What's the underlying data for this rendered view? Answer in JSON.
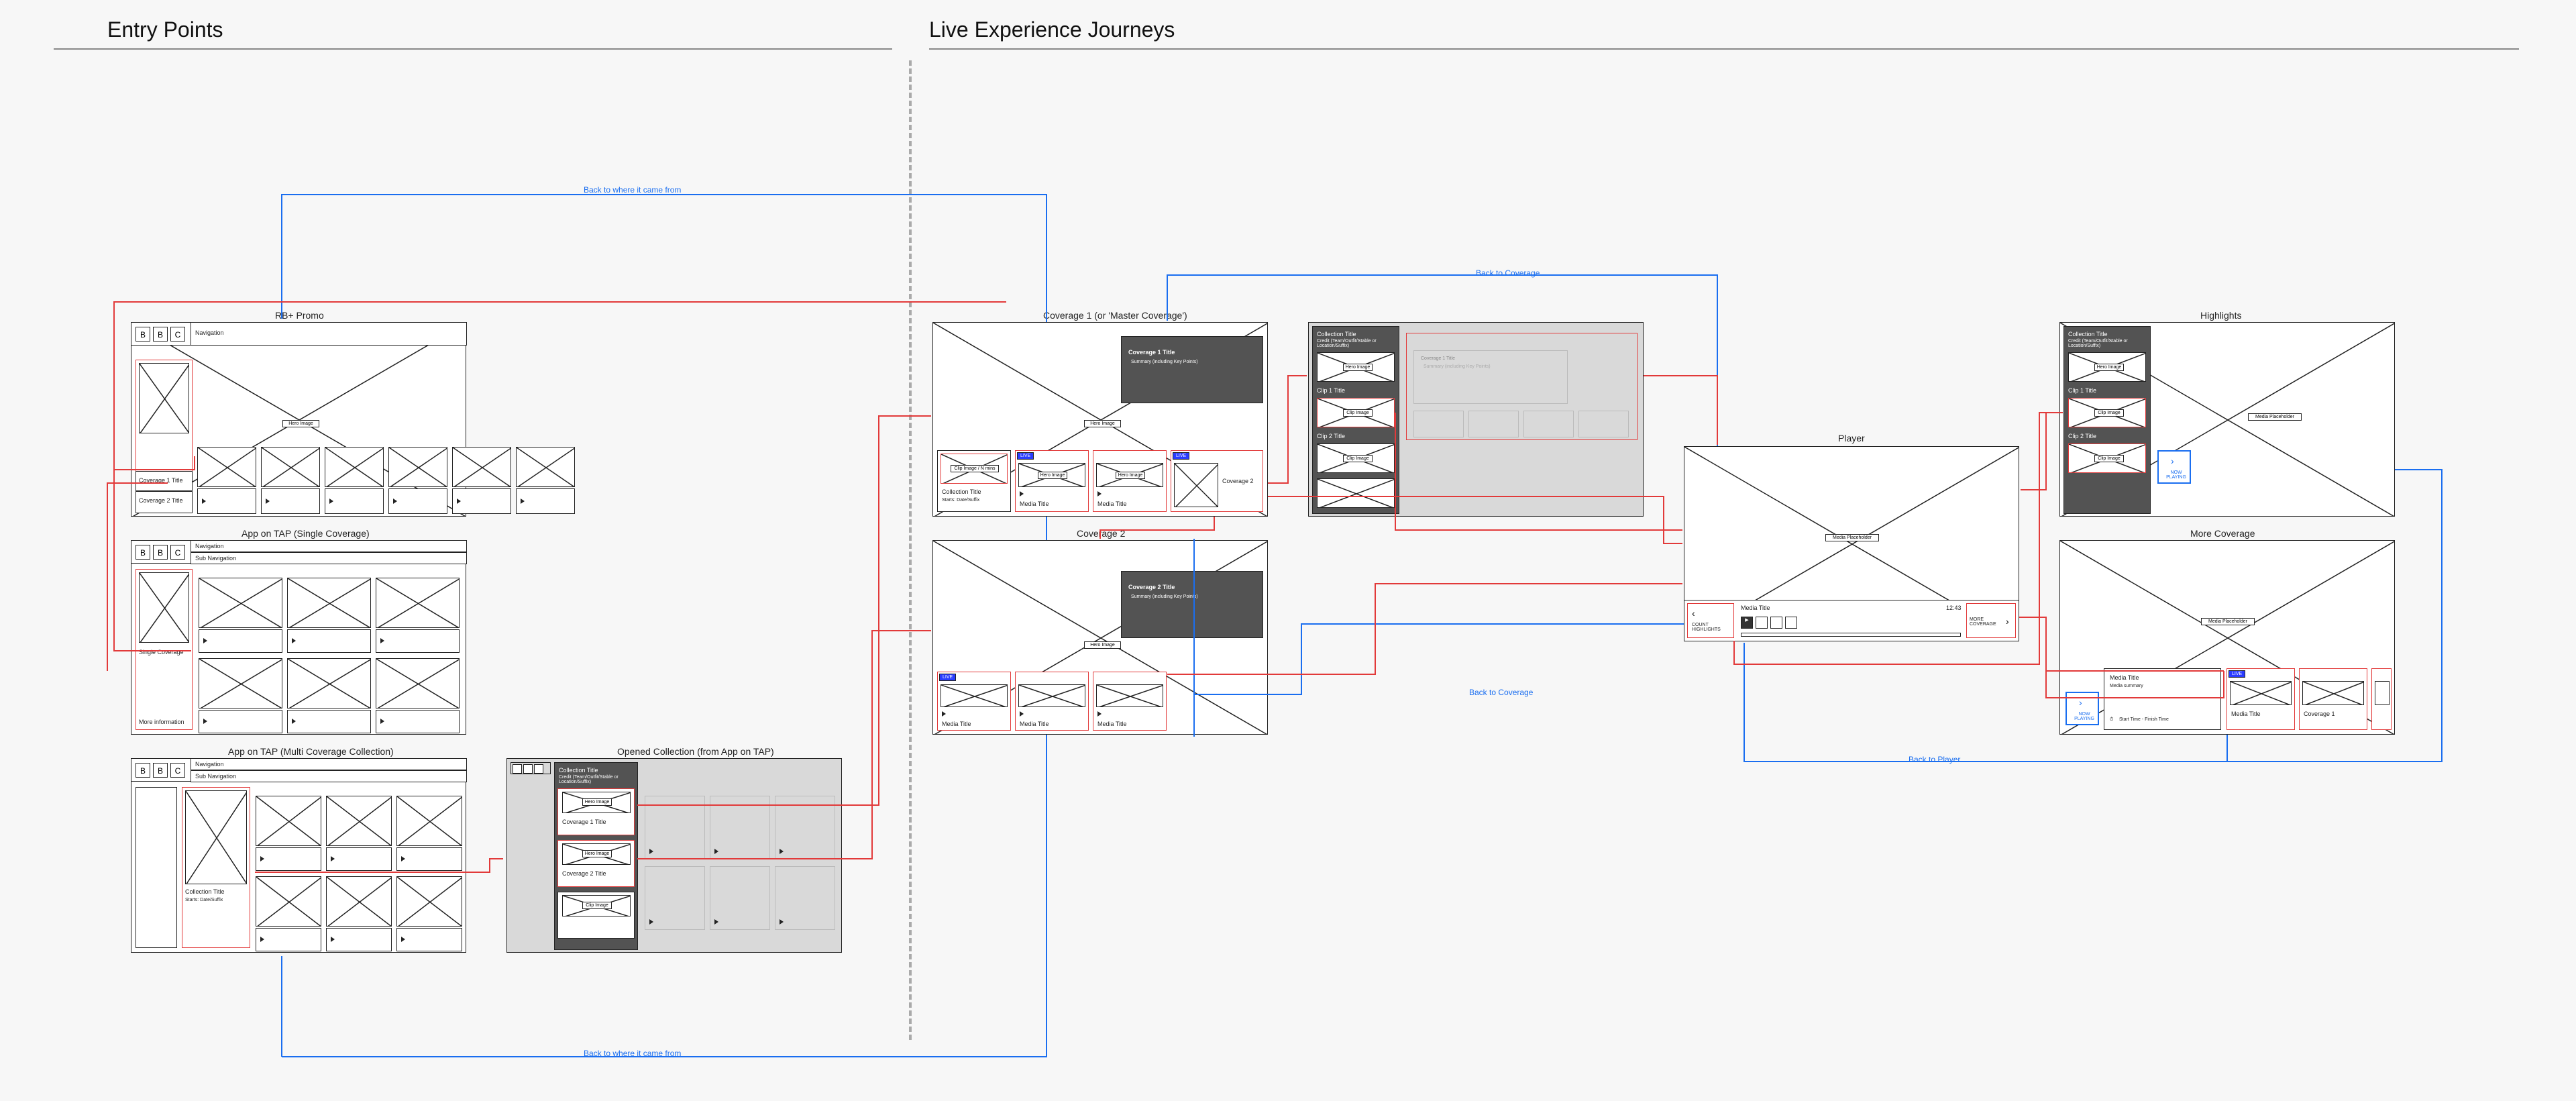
{
  "sections": {
    "left": "Entry Points",
    "right": "Live Experience Journeys"
  },
  "flow_labels": {
    "back_where_top": "Back to where it came from",
    "back_where_bottom": "Back to where it came from",
    "back_coverage_top": "Back to Coverage",
    "back_coverage_mid": "Back to Coverage",
    "back_player": "Back to Player"
  },
  "frames": {
    "rbplus": {
      "title": "RB+ Promo",
      "logo": [
        "B",
        "B",
        "C"
      ],
      "nav": "Navigation",
      "hero_badge": "Hero Image",
      "cov1": "Coverage 1 Title",
      "cov2": "Coverage 2 Title"
    },
    "single": {
      "title": "App on TAP (Single Coverage)",
      "logo": [
        "B",
        "B",
        "C"
      ],
      "nav": "Navigation",
      "subnav": "Sub Navigation",
      "item": "Single Coverage",
      "more": "More information"
    },
    "multi": {
      "title": "App on TAP (Multi Coverage Collection)",
      "logo": [
        "B",
        "B",
        "C"
      ],
      "nav": "Navigation",
      "subnav": "Sub Navigation",
      "coll_title": "Collection Title",
      "coll_sub": "Starts: Date/Suffix"
    },
    "opened": {
      "title": "Opened Collection (from App on TAP)",
      "coll_title": "Collection Title",
      "coll_sub": "Credit (Team/Outfit/Stable or Location/Suffix)",
      "hero": "Hero Image",
      "cov1": "Coverage 1 Title",
      "cov2": "Coverage 2 Title",
      "clip": "Clip Image"
    },
    "coverage1": {
      "title": "Coverage 1 (or 'Master Coverage')",
      "hero": "Hero Image",
      "panel_title": "Coverage 1 Title",
      "panel_sub": "Summary (including Key Points)",
      "clip_btn": "Clip Image / N mins",
      "media_title": "Media Title",
      "coll_title": "Collection Title",
      "coll_sub": "Starts: Date/Suffix",
      "live": "LIVE",
      "cov2": "Coverage 2"
    },
    "coverage2": {
      "title": "Coverage 2",
      "hero": "Hero Image",
      "panel_title": "Coverage 2 Title",
      "panel_sub": "Summary (including Key Points)",
      "media_title": "Media Title",
      "live": "LIVE"
    },
    "collection_panel": {
      "coll_title": "Collection Title",
      "coll_sub": "Credit (Team/Outfit/Stable or Location/Suffix)",
      "hero": "Hero Image",
      "clip1": "Clip 1 Title",
      "clip2": "Clip 2 Title",
      "clip_btn": "Clip Image",
      "cov1_title": "Coverage 1 Title",
      "cov1_sub": "Summary (including Key Points)"
    },
    "player": {
      "title": "Player",
      "placeholder": "Media Placeholder",
      "media_title": "Media Title",
      "time": "12:43",
      "count_highlights": "COUNT HIGHLIGHTS",
      "more_coverage": "MORE COVERAGE"
    },
    "highlights": {
      "title": "Highlights",
      "coll_title": "Collection Title",
      "coll_sub": "Credit (Team/Outfit/Stable or Location/Suffix)",
      "hero": "Hero Image",
      "clip1": "Clip 1 Title",
      "clip2": "Clip 2 Title",
      "clip_btn": "Clip Image",
      "placeholder": "Media Placeholder",
      "now_playing": "NOW PLAYING"
    },
    "more_coverage": {
      "title": "More Coverage",
      "placeholder": "Media Placeholder",
      "media_title": "Media Title",
      "media_sub": "Media summary",
      "live": "LIVE",
      "cov1": "Coverage 1",
      "start_end": "Start Time - Finish Time",
      "now_playing": "NOW PLAYING"
    }
  }
}
